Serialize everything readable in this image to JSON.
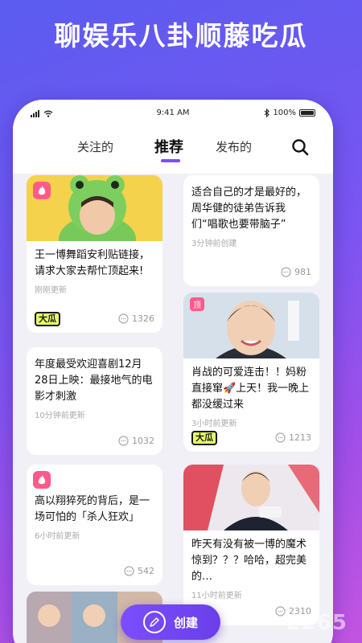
{
  "headline": "聊娱乐八卦顺藤吃瓜",
  "status_bar": {
    "time": "9:41 AM",
    "battery": "100%"
  },
  "tabs": [
    {
      "label": "关注的"
    },
    {
      "label": "推荐"
    },
    {
      "label": "发布的"
    }
  ],
  "cards": [
    {
      "text": "王一博舞蹈安利贴链接，请求大家去帮忙顶起来!",
      "time": "刚刚更新",
      "comments": "1326",
      "source_logo": "大瓜"
    },
    {
      "text": "适合自己的才是最好的，周华健的徒弟告诉我们“唱歌也要带脑子”",
      "time": "3分钟前创建",
      "comments": "981"
    },
    {
      "text": "年度最受欢迎喜剧12月28日上映：最接地气的电影才刺激",
      "time": "10分钟前更新",
      "comments": "1032"
    },
    {
      "text": "肖战的可爱连击！！妈粉直接窜🚀上天！我一晚上都没缓过来",
      "time": "3小时前更新",
      "comments": "1213",
      "source_logo": "大瓜",
      "badge": "顶"
    },
    {
      "text": "高以翔猝死的背后，是一场可怕的「杀人狂欢」",
      "time": "6小时前更新",
      "comments": "542"
    },
    {
      "text": "昨天有没有被一博的魔术惊到？？？哈哈，超完美的…",
      "time": "11小时前更新",
      "comments": "2310"
    }
  ],
  "create_button": {
    "label": "创建"
  },
  "watermark": "2265"
}
